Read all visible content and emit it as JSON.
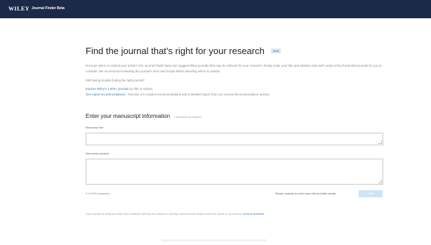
{
  "header": {
    "brand": "WILEY",
    "app_name": "Journal Finder Beta"
  },
  "intro": {
    "title": "Find the journal that’s right for your research",
    "badge": "Beta",
    "paragraph": "Not sure where to submit your article? Our Journal Finder Beta can suggest Wiley journals that may be relevant for your research. Simply enter your title and abstract and we’ll create a list of potential journals for you to consider. We recommend reviewing the journal’s Aims and Scope before deciding where to submit.",
    "trouble": "Still having trouble finding the right journal?",
    "explore_link": "Explore Wiley’s 1,600+ journals",
    "explore_suffix": " by title or subject",
    "expert_link": "Get expert recommendations",
    "expert_suffix": " - Receive 3-5 curated recommendations and a detailed report from our Journal Recommendation Service"
  },
  "form": {
    "section_title": "Enter your manuscript information",
    "required_note": "* Both fields are required",
    "title_label": "Manuscript title",
    "title_value": "",
    "abstract_label": "Manuscript abstract",
    "abstract_value": "",
    "char_count": "0 of 5000 characters",
    "hint": "Please continue to enter more info for better results",
    "find_button": "FIND"
  },
  "feedback": {
    "text": "Try it and tell us what you think! Your feedback will help us continue to develop Journal Finder Beta to meet the needs of our authors. ",
    "link": "Send us feedback"
  }
}
